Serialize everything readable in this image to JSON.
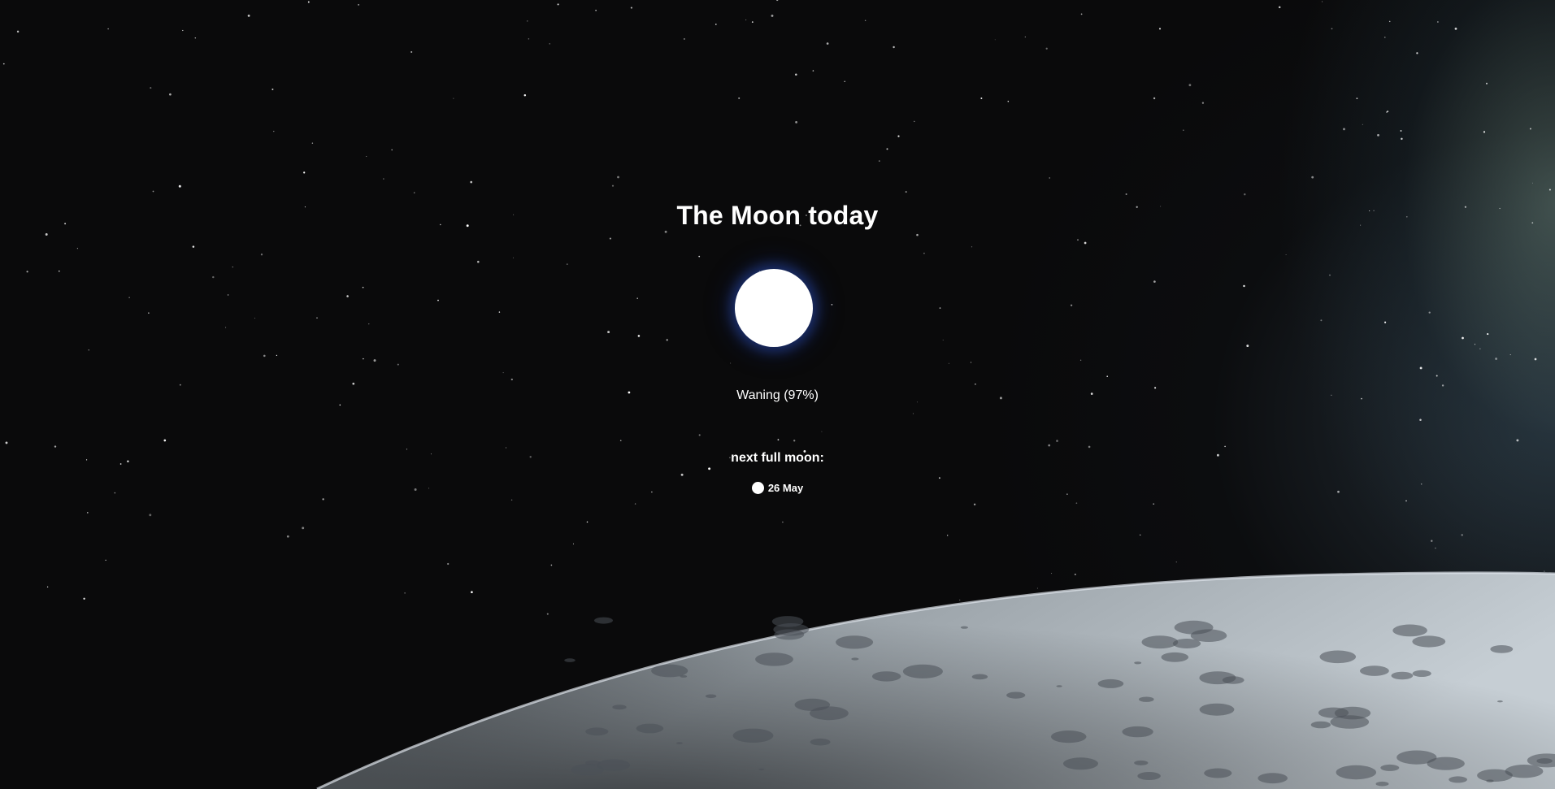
{
  "page": {
    "title": "The Moon today"
  },
  "moon": {
    "phase_text": "Waning (97%)",
    "illumination_percent": 97,
    "icon": "full-moon-disc"
  },
  "next_full_moon": {
    "label": "next full moon:",
    "date": "26 May",
    "icon": "full-moon-icon"
  },
  "colors": {
    "background": "#0a0a0b",
    "text": "#ffffff",
    "moon": "#ffffff",
    "moon_glow": "#2a46a0"
  }
}
